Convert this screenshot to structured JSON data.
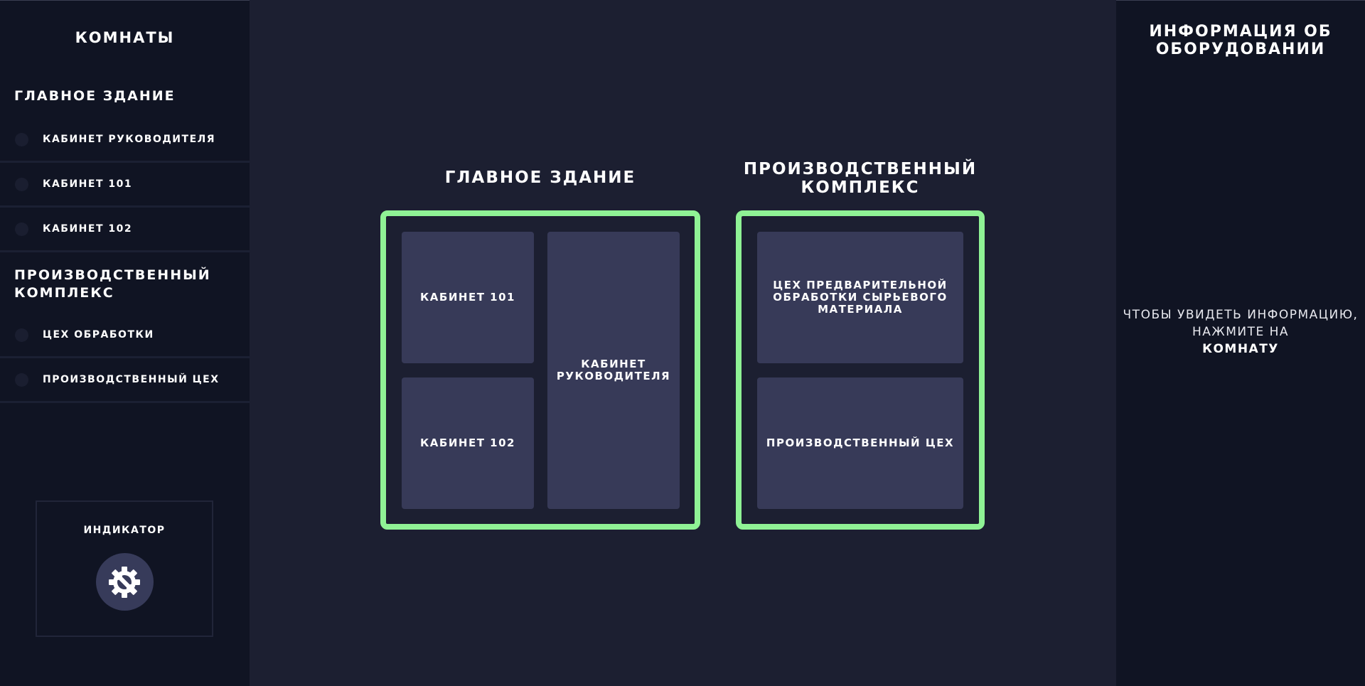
{
  "sidebar": {
    "title": "КОМНАТЫ",
    "groups": [
      {
        "title": "ГЛАВНОЕ ЗДАНИЕ",
        "items": [
          {
            "label": "КАБИНЕТ РУКОВОДИТЕЛЯ"
          },
          {
            "label": "КАБИНЕТ 101"
          },
          {
            "label": "КАБИНЕТ 102"
          }
        ]
      },
      {
        "title": "ПРОИЗВОДСТВЕННЫЙ КОМПЛЕКС",
        "items": [
          {
            "label": "ЦЕХ ОБРАБОТКИ"
          },
          {
            "label": "ПРОИЗВОДСТВЕННЫЙ ЦЕХ"
          }
        ]
      }
    ],
    "indicator": {
      "label": "ИНДИКАТОР",
      "icon": "gear-wrench-icon"
    }
  },
  "map": {
    "buildings": [
      {
        "title": "ГЛАВНОЕ ЗДАНИЕ",
        "rooms": [
          {
            "label": "КАБИНЕТ 101"
          },
          {
            "label": "КАБИНЕТ 102"
          },
          {
            "label": "КАБИНЕТ РУКОВОДИТЕЛЯ"
          }
        ]
      },
      {
        "title": "ПРОИЗВОДСТВЕННЫЙ КОМПЛЕКС",
        "rooms": [
          {
            "label": "ЦЕХ ПРЕДВАРИТЕЛЬНОЙ ОБРАБОТКИ СЫРЬЕВОГО МАТЕРИАЛА"
          },
          {
            "label": "ПРОИЗВОДСТВЕННЫЙ ЦЕХ"
          }
        ]
      }
    ],
    "border_color": "#8ff295",
    "room_color": "#373a58"
  },
  "info": {
    "title": "ИНФОРМАЦИЯ ОБ ОБОРУДОВАНИИ",
    "hint_prefix": "ЧТОБЫ УВИДЕТЬ ИНФОРМАЦИЮ, НАЖМИТЕ НА",
    "hint_bold": "КОМНАТУ"
  }
}
